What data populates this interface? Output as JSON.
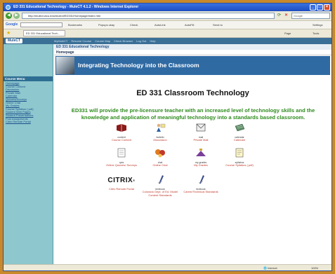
{
  "window": {
    "title": "ED 331 Educational Technology - MuleCT 4.1.2 - Windows Internet Explorer"
  },
  "address": {
    "url": "http://mulect.wcu.edu/mulect/ED331/Homepage/index.htm"
  },
  "toolbar": {
    "google_label": "Google",
    "search_placeholder": "Google",
    "items": [
      "Bookmarks",
      "Popups okay",
      "Check",
      "AutoLink",
      "AutoFill",
      "Send to",
      "Settings"
    ]
  },
  "favorites": {
    "tab_label": "ED 331 Educational Tech...",
    "page_label": "Page",
    "tools_label": "Tools"
  },
  "site": {
    "brand": "MuleCT",
    "nav_links": [
      "MyMuleCT",
      "Resume Course",
      "Course Map",
      "Check Browser",
      "Log Out",
      "Help"
    ],
    "course_title": "ED 331 Educational Technology"
  },
  "sidebar": {
    "menu_header": "Course Menu",
    "items": [
      "Homepage",
      "Course Content",
      "Discussion",
      "Private Mail",
      "Calendar",
      "Quizzes/Surveys",
      "Online Chat",
      "My Grades",
      "Course Syllabus (.pdf)",
      "Student Web Pages",
      "Student Presentations",
      "Post Assignments",
      "Citrix Remote Portal"
    ]
  },
  "page": {
    "header": "Homepage",
    "banner": "Integrating Technology into the Classroom",
    "title": "ED 331 Classroom Technology",
    "description": "ED331 will provide the pre-licensure teacher with an increased level of technology skills and the knowledge and application of meaningful technology into a standards based classroom."
  },
  "tiles": [
    {
      "caption": "content",
      "label": "Course Content",
      "icon": "book-icon"
    },
    {
      "caption": "bulletin",
      "label": "Discussion",
      "icon": "discussion-icon"
    },
    {
      "caption": "mail",
      "label": "Private Mail",
      "icon": "mail-icon"
    },
    {
      "caption": "calendar",
      "label": "Calendar",
      "icon": "calendar-icon"
    },
    {
      "caption": "quiz",
      "label": "Online Quizzes/ Surveys",
      "icon": "quiz-icon"
    },
    {
      "caption": "chat",
      "label": "Online Chat",
      "icon": "chat-icon"
    },
    {
      "caption": "my grades",
      "label": "My Grades",
      "icon": "grades-icon"
    },
    {
      "caption": "syllabus",
      "label": "Course Syllabus (.pdf)",
      "icon": "syllabus-icon"
    },
    {
      "caption": "",
      "label": "Citrix Remote Portal",
      "icon": "citrix-logo"
    },
    {
      "caption": "textbook",
      "label": "Colorado Dept. of Ed. Model Content Standards",
      "icon": "standards-icon"
    },
    {
      "caption": "textbook",
      "label": "Career/Technical Standards",
      "icon": "standards-icon"
    }
  ],
  "statusbar": {
    "zone": "Internet",
    "zoom": "100%"
  },
  "colors": {
    "banner": "#2f6aa3",
    "sidebar": "#8ec7cd",
    "description": "#2e8b1e",
    "link": "#c0392b"
  }
}
